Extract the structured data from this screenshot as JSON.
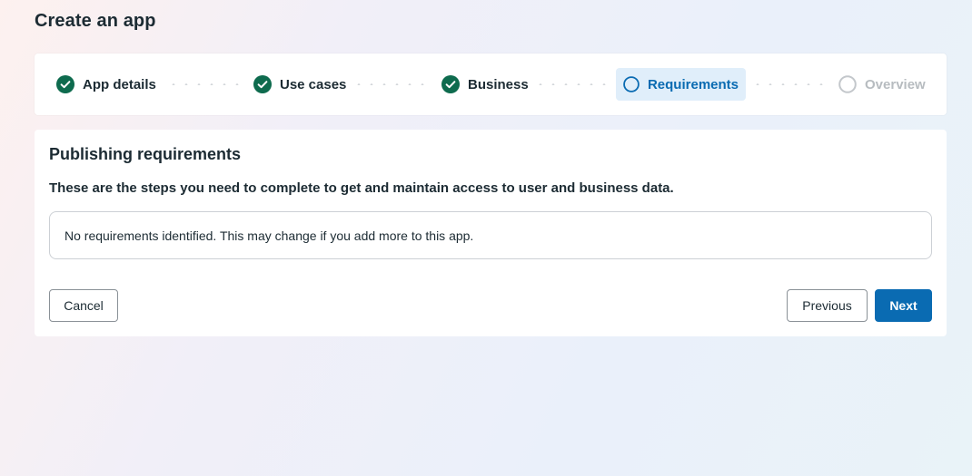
{
  "page": {
    "title": "Create an app"
  },
  "stepper": {
    "steps": [
      {
        "label": "App details",
        "state": "completed",
        "icon": "check-circle-icon"
      },
      {
        "label": "Use cases",
        "state": "completed",
        "icon": "check-circle-icon"
      },
      {
        "label": "Business",
        "state": "completed",
        "icon": "check-circle-icon"
      },
      {
        "label": "Requirements",
        "state": "active",
        "icon": "empty-circle-icon"
      },
      {
        "label": "Overview",
        "state": "future",
        "icon": "empty-circle-icon"
      }
    ]
  },
  "requirements": {
    "title": "Publishing requirements",
    "description": "These are the steps you need to complete to get and maintain access to user and business data.",
    "empty_message": "No requirements identified. This may change if you add more to this app."
  },
  "actions": {
    "cancel_label": "Cancel",
    "previous_label": "Previous",
    "next_label": "Next"
  },
  "colors": {
    "completed": "#0e6b4e",
    "primary": "#0a6bb2",
    "active_bg": "#e0eefa",
    "future": "#b7bcc0"
  }
}
